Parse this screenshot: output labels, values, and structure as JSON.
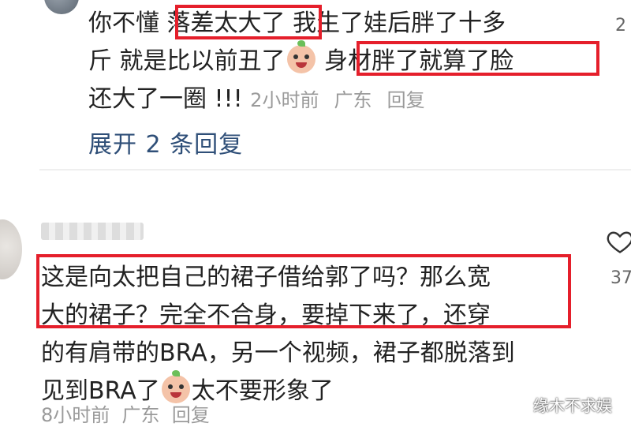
{
  "reply": {
    "line1_prefix": "你不懂 ",
    "highlight1": "落差太大了",
    "line1_suffix": " 我生了娃后胖了十多",
    "line2_prefix": "斤  就是比以前丑了",
    "highlight2": " 身材胖了就算了脸",
    "line3": "还大了一圈 !!!",
    "time": "2小时前",
    "location": "广东",
    "reply_label": "回复",
    "side_count": "2"
  },
  "expand_label": "展开 2 条回复",
  "comment": {
    "highlight_line1": "这是向太把自己的裙子借给郭了吗？那么宽",
    "highlight_line2": "大的裙子？完全不合身，要掉下来了，还穿",
    "line3": "的有肩带的BRA，另一个视频，裙子都脱落到",
    "line4_prefix": "见到BRA了",
    "line4_suffix": "太不要形象了",
    "time": "8小时前",
    "location": "广东",
    "reply_label": "回复",
    "like_count": "37"
  },
  "watermark": "缘木不求娱",
  "colors": {
    "highlight_border": "#e51f2b",
    "link": "#2f4f78",
    "meta": "#9a9a9a"
  },
  "icons": {
    "emoji": "crying-face-emoji",
    "like": "heart-outline-icon"
  }
}
